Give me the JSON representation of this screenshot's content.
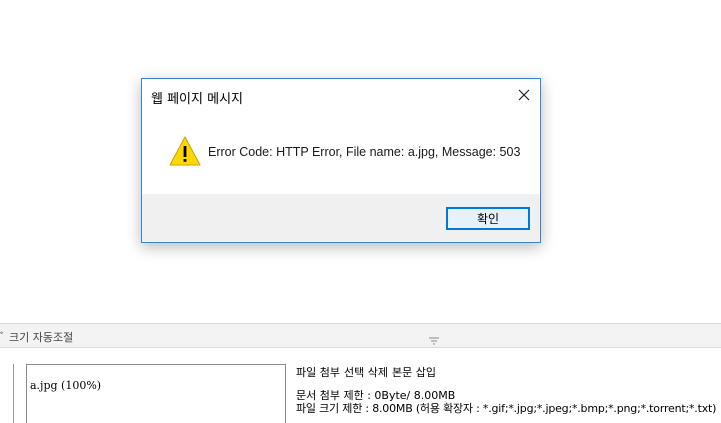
{
  "dialog": {
    "title": "웹 페이지 메시지",
    "message": "Error Code: HTTP Error, File name: a.jpg, Message: 503",
    "ok_label": "확인",
    "close_icon": "close-icon",
    "warning_icon": "warning-icon",
    "accent_color": "#0078d7"
  },
  "editor": {
    "resize_label": "ﾞ 크기 자동조절",
    "resize_handle_icon": "resize-handle-icon"
  },
  "attachments": {
    "files": [
      {
        "label": "a.jpg (100%)"
      }
    ],
    "actions": [
      "파일 첨부",
      "선택 삭제",
      "본문 삽입"
    ],
    "doc_limit": "문서 첨부 제한 : 0Byte/ 8.00MB",
    "file_limit": "파일 크기 제한 : 8.00MB (허용 확장자 : *.gif;*.jpg;*.jpeg;*.bmp;*.png;*.torrent;*.txt)"
  }
}
